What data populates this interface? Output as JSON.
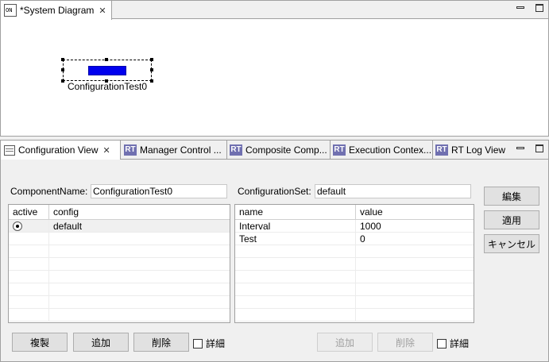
{
  "editor": {
    "tab_title": "*System Diagram",
    "component_label": "ConfigurationTest0",
    "component_color": "#0000ee"
  },
  "view": {
    "tabs": [
      {
        "label": "Configuration View",
        "icon": "config-view-icon"
      },
      {
        "label": "Manager Control ...",
        "icon": "rt-icon"
      },
      {
        "label": "Composite Comp...",
        "icon": "rt-icon"
      },
      {
        "label": "Execution Contex...",
        "icon": "rt-icon"
      },
      {
        "label": "RT Log View",
        "icon": "rt-icon"
      }
    ],
    "rt_icon_text": "RT",
    "component_name_label": "ComponentName:",
    "component_name_value": "ConfigurationTest0",
    "configuration_set_label": "ConfigurationSet:",
    "configuration_set_value": "default",
    "config_table": {
      "headers": [
        "active",
        "config"
      ],
      "rows": [
        {
          "config": "default",
          "active": true
        }
      ]
    },
    "param_table": {
      "headers": [
        "name",
        "value"
      ],
      "rows": [
        {
          "name": "Interval",
          "value": "1000"
        },
        {
          "name": "Test",
          "value": "0"
        }
      ]
    },
    "side_buttons": {
      "edit": "編集",
      "apply": "適用",
      "cancel": "キャンセル"
    },
    "left_buttons": {
      "duplicate": "複製",
      "add": "追加",
      "delete": "削除",
      "detail": "詳細"
    },
    "right_buttons": {
      "add": "追加",
      "delete": "削除",
      "detail": "詳細"
    }
  }
}
